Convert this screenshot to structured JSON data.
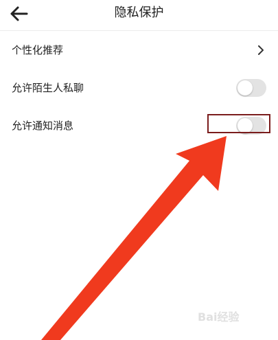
{
  "header": {
    "back_icon": "arrow-left-icon",
    "title": "隐私保护"
  },
  "settings": [
    {
      "label": "个性化推荐",
      "control": "chevron",
      "icon": "chevron-right-icon"
    },
    {
      "label": "允许陌生人私聊",
      "control": "toggle",
      "on": false
    },
    {
      "label": "允许通知消息",
      "control": "toggle",
      "on": false
    }
  ],
  "annotation": {
    "highlight_color": "#7a1c1c",
    "arrow_color": "#f03a1e"
  },
  "colors": {
    "toggle_off_track": "#e3e3e3",
    "toggle_knob": "#ffffff",
    "text": "#222222"
  }
}
